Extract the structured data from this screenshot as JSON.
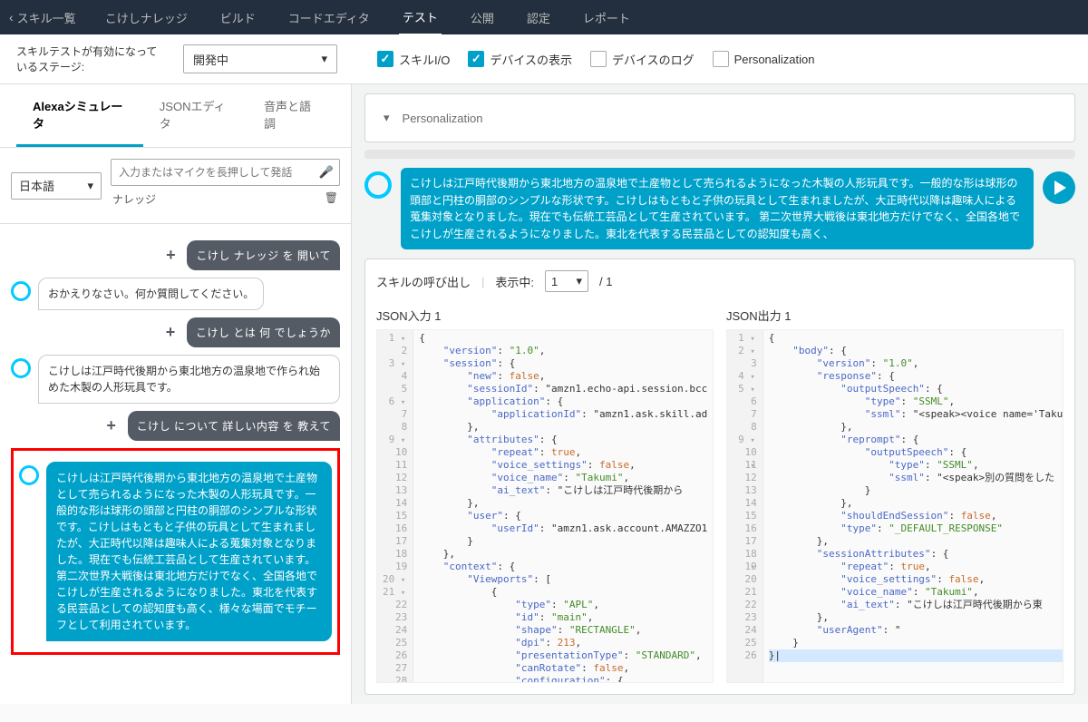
{
  "nav": {
    "back": "スキル一覧",
    "items": [
      "こけしナレッジ",
      "ビルド",
      "コードエディタ",
      "テスト",
      "公開",
      "認定",
      "レポート"
    ],
    "active_index": 3
  },
  "stage": {
    "label": "スキルテストが有効になっているステージ:",
    "value": "開発中",
    "checks": [
      {
        "label": "スキルI/O",
        "checked": true
      },
      {
        "label": "デバイスの表示",
        "checked": true
      },
      {
        "label": "デバイスのログ",
        "checked": false
      },
      {
        "label": "Personalization",
        "checked": false
      }
    ]
  },
  "subtabs": [
    "Alexaシミュレータ",
    "JSONエディタ",
    "音声と語調"
  ],
  "subtabs_active": 0,
  "locale": "日本語",
  "utterance_placeholder": "入力またはマイクを長押しして発話",
  "knowledge_label": "ナレッジ",
  "chat": {
    "u1": "こけし ナレッジ を 開いて",
    "a1": "おかえりなさい。何か質問してください。",
    "u2": "こけし とは 何 でしょうか",
    "a2": "こけしは江戸時代後期から東北地方の温泉地で作られ始めた木製の人形玩具です。",
    "u3": "こけし について 詳しい内容 を 教えて",
    "a3": "こけしは江戸時代後期から東北地方の温泉地で土産物として売られるようになった木製の人形玩具です。一般的な形は球形の頭部と円柱の胴部のシンプルな形状です。こけしはもともと子供の玩具として生まれましたが、大正時代以降は趣味人による蒐集対象となりました。現在でも伝統工芸品として生産されています。 第二次世界大戦後は東北地方だけでなく、全国各地でこけしが生産されるようになりました。東北を代表する民芸品としての認知度も高く、様々な場面でモチーフとして利用されています。"
  },
  "right": {
    "personalization": "Personalization",
    "response_trunc": "こけしは江戸時代後期から東北地方の温泉地で土産物として売られるようになった木製の人形玩具です。一般的な形は球形の頭部と円柱の胴部のシンプルな形状です。こけしはもともと子供の玩具として生まれましたが、大正時代以降は趣味人による蒐集対象となりました。現在でも伝統工芸品として生産されています。 第二次世界大戦後は東北地方だけでなく、全国各地でこけしが生産されるようになりました。東北を代表する民芸品としての認知度も高く、",
    "invoke_label": "スキルの呼び出し",
    "showing_label": "表示中:",
    "page_current": "1",
    "page_total": "/ 1",
    "json_in_title": "JSON入力 1",
    "json_out_title": "JSON出力 1"
  },
  "json_input": [
    "{",
    "    \"version\": \"1.0\",",
    "    \"session\": {",
    "        \"new\": false,",
    "        \"sessionId\": \"amzn1.echo-api.session.bcc",
    "        \"application\": {",
    "            \"applicationId\": \"amzn1.ask.skill.ad",
    "        },",
    "        \"attributes\": {",
    "            \"repeat\": true,",
    "            \"voice_settings\": false,",
    "            \"voice_name\": \"Takumi\",",
    "            \"ai_text\": \"こけしは江戸時代後期から",
    "        },",
    "        \"user\": {",
    "            \"userId\": \"amzn1.ask.account.AMAZZO1",
    "        }",
    "    },",
    "    \"context\": {",
    "        \"Viewports\": [",
    "            {",
    "                \"type\": \"APL\",",
    "                \"id\": \"main\",",
    "                \"shape\": \"RECTANGLE\",",
    "                \"dpi\": 213,",
    "                \"presentationType\": \"STANDARD\",",
    "                \"canRotate\": false,",
    "                \"configuration\": {"
  ],
  "json_output": [
    "{",
    "    \"body\": {",
    "        \"version\": \"1.0\",",
    "        \"response\": {",
    "            \"outputSpeech\": {",
    "                \"type\": \"SSML\",",
    "                \"ssml\": \"<speak><voice name='Takum",
    "            },",
    "            \"reprompt\": {",
    "                \"outputSpeech\": {",
    "                    \"type\": \"SSML\",",
    "                    \"ssml\": \"<speak>別の質問をした",
    "                }",
    "            },",
    "            \"shouldEndSession\": false,",
    "            \"type\": \"_DEFAULT_RESPONSE\"",
    "        },",
    "        \"sessionAttributes\": {",
    "            \"repeat\": true,",
    "            \"voice_settings\": false,",
    "            \"voice_name\": \"Takumi\",",
    "            \"ai_text\": \"こけしは江戸時代後期から東",
    "        },",
    "        \"userAgent\": \"                          ",
    "    }",
    "}|"
  ],
  "fold_lines_in": [
    1,
    3,
    6,
    9,
    20,
    21
  ],
  "fold_lines_out": [
    1,
    2,
    4,
    5,
    9,
    10,
    18
  ],
  "hl_line_out": 26
}
